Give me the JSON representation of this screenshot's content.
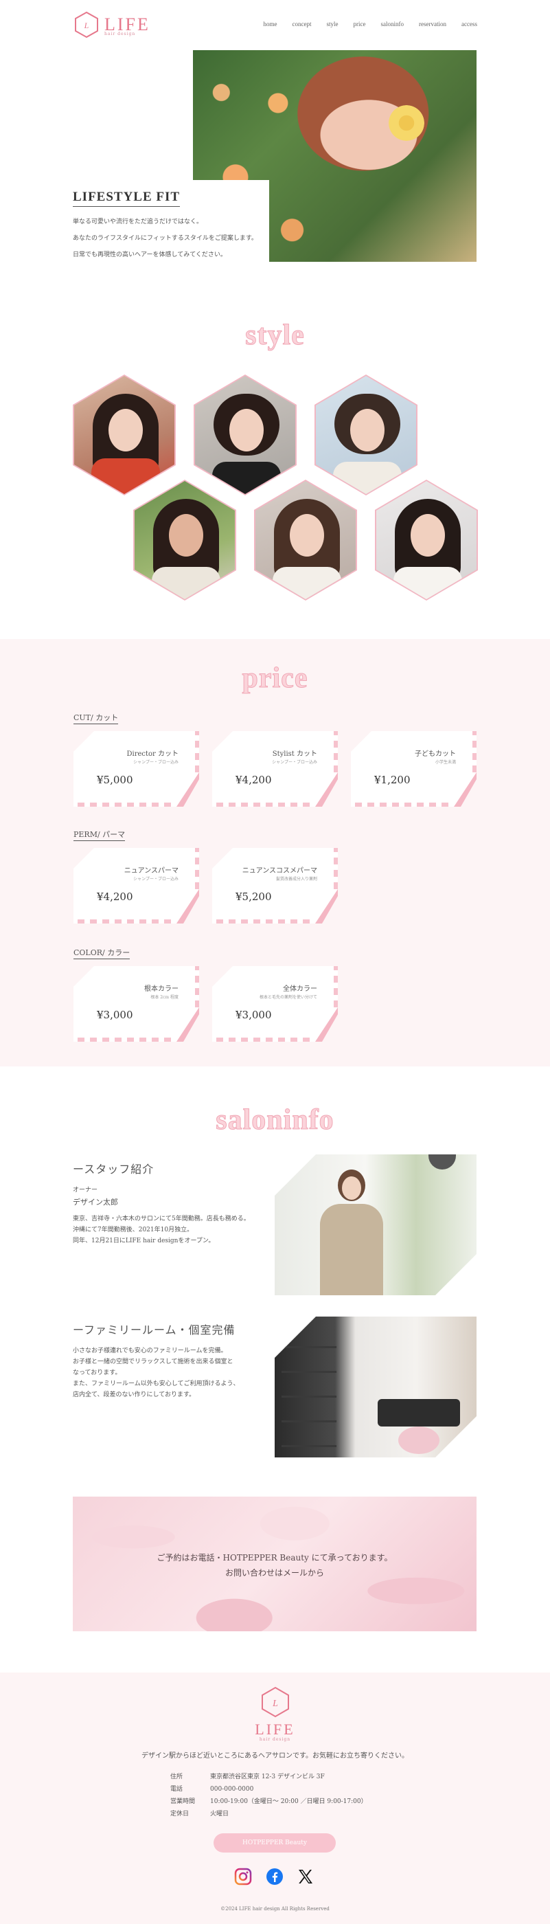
{
  "brand": {
    "name": "LIFE",
    "sub": "hair design"
  },
  "nav": [
    "home",
    "concept",
    "style",
    "price",
    "saloninfo",
    "reservation",
    "access"
  ],
  "hero": {
    "title": "LIFESTYLE FIT",
    "lines": [
      "単なる可愛いや流行をただ追うだけではなく。",
      "あなたのライフスタイルにフィットするスタイルをご提案します。",
      "日常でも再現性の高いヘアーを体感してみてください。"
    ]
  },
  "style_title": "style",
  "price_title": "price",
  "price": {
    "cut_label": "CUT/ カット",
    "perm_label": "PERM/ パーマ",
    "color_label": "COLOR/ カラー",
    "cut": [
      {
        "name": "Director カット",
        "sub": "シャンプー・ブロー込み",
        "price": "¥5,000"
      },
      {
        "name": "Stylist カット",
        "sub": "シャンプー・ブロー込み",
        "price": "¥4,200"
      },
      {
        "name": "子どもカット",
        "sub": "小学生未満",
        "price": "¥1,200"
      }
    ],
    "perm": [
      {
        "name": "ニュアンスパーマ",
        "sub": "シャンプー・ブロー込み",
        "price": "¥4,200"
      },
      {
        "name": "ニュアンスコスメパーマ",
        "sub": "髪質改善成分入り薬剤",
        "price": "¥5,200"
      }
    ],
    "color": [
      {
        "name": "根本カラー",
        "sub": "根本 2cm 程度",
        "price": "¥3,000"
      },
      {
        "name": "全体カラー",
        "sub": "根本と毛先の薬剤を使い分けて",
        "price": "¥3,000"
      }
    ]
  },
  "saloninfo_title": "saloninfo",
  "staff": {
    "heading": "ースタッフ紹介",
    "role": "オーナー",
    "name": "デザイン太郎",
    "lines": [
      "東京、吉祥寺・六本木のサロンにて5年間勤務。店長も務める。",
      "沖縄にて7年間勤務後、2021年10月独立。",
      "同年、12月21日にLIFE hair designをオープン。"
    ]
  },
  "family": {
    "heading": "ーファミリールーム・個室完備",
    "lines": [
      "小さなお子様連れでも安心のファミリールームを完備。",
      "お子様と一緒の空間でリラックスして施術を出来る個室と",
      "なっております。",
      "また、ファミリールーム以外も安心してご利用頂けるよう、",
      "店内全て、段差のない作りにしております。"
    ]
  },
  "banner": {
    "line1": "ご予約はお電話・HOTPEPPER Beauty にて承っております。",
    "line2": "お問い合わせはメールから"
  },
  "footer": {
    "tagline": "デザイン駅からほど近いところにあるヘアサロンです。お気軽にお立ち寄りください。",
    "rows": [
      {
        "k": "住所",
        "v": "東京都渋谷区東京 12-3 デザインビル 3F"
      },
      {
        "k": "電話",
        "v": "000-000-0000"
      },
      {
        "k": "営業時間",
        "v": "10:00-19:00（金曜日～ 20:00 ／日曜日 9:00-17:00）"
      },
      {
        "k": "定休日",
        "v": "火曜日"
      }
    ],
    "button": "HOTPEPPER Beauty",
    "copyright": "©2024 LIFE hair design All Rights Reserved"
  }
}
